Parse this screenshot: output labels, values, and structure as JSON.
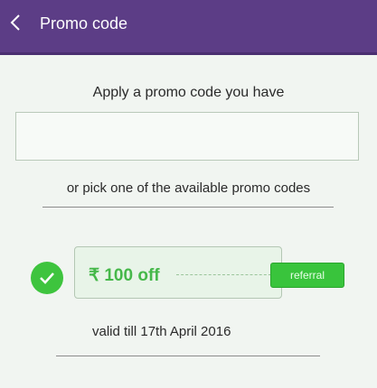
{
  "header": {
    "back_icon": "chevron-left-icon",
    "title": "Promo code"
  },
  "main": {
    "apply_text": "Apply a promo code you have",
    "promo_input": {
      "value": "",
      "placeholder": ""
    },
    "pick_text": "or pick one of the available promo codes"
  },
  "coupons": [
    {
      "selected": true,
      "check_icon": "checkmark-icon",
      "amount": "₹ 100 off",
      "tag": "referral",
      "validity": "valid till 17th April 2016"
    }
  ],
  "colors": {
    "appbar": "#5c3d86",
    "accent_green": "#3ec43e",
    "coupon_text": "#46b84a"
  }
}
